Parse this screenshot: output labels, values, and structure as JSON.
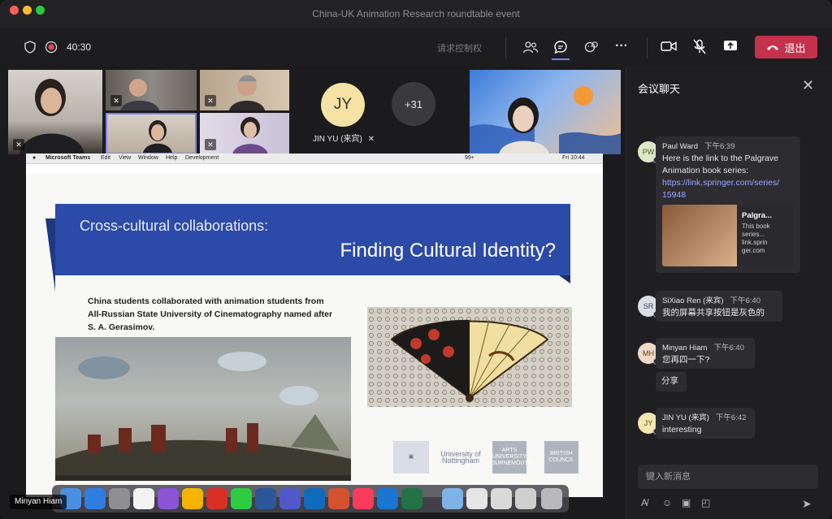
{
  "window": {
    "title": "China-UK Animation Research roundtable event"
  },
  "toolbar": {
    "timer": "40:30",
    "request_control": "请求控制权",
    "leave_label": "退出",
    "icons": [
      "shield-icon",
      "record-icon",
      "people-icon",
      "chat-icon",
      "reactions-icon",
      "more-icon",
      "camera-icon",
      "mic-off-icon",
      "share-icon",
      "phone-icon"
    ]
  },
  "participants": {
    "jin_yu_initials": "JY",
    "jin_yu_name": "JIN YU (来宾)",
    "overflow_count": "+31"
  },
  "shared_screen": {
    "menubar": {
      "app": "Microsoft Teams",
      "items": [
        "Edit",
        "View",
        "Window",
        "Help",
        "Development"
      ],
      "status_badge": "99+",
      "clock": "Fri 10:44"
    },
    "slide": {
      "title_line1": "Cross-cultural collaborations:",
      "title_line2": "Finding Cultural Identity?",
      "body_lines": [
        "China students collaborated with animation students from",
        "All-Russian State University of Cinematography named after",
        "S. A. Gerasimov."
      ],
      "logos": [
        "University of Nottingham",
        "ARTS UNIVERSITY BOURNEMOUTH",
        "BRITISH COUNCIL"
      ]
    },
    "presenter_name": "Minyan Hiam"
  },
  "chat": {
    "title": "会议聊天",
    "messages": [
      {
        "initials": "PW",
        "name": "Paul Ward",
        "time": "下午6:39",
        "lines": [
          "Here is the link to the Palgrave",
          "Animation book series:"
        ],
        "link_lines": [
          "https://link.springer.com/series/",
          "15948"
        ],
        "preview": {
          "title": "Palgra...",
          "desc_lines": [
            "This book",
            "series..."
          ],
          "domain_lines": [
            "link.sprin",
            "ger.com"
          ]
        }
      },
      {
        "initials": "SR",
        "name": "SiXiao Ren (来宾)",
        "time": "下午6:40",
        "lines": [
          "我的屏幕共享按钮是灰色的"
        ]
      },
      {
        "initials": "MH",
        "name": "Minyan Hiam",
        "time": "下午6:40",
        "lines": [
          "您再四一下?"
        ],
        "extra": "分享"
      },
      {
        "initials": "JY",
        "name": "JIN YU (来宾)",
        "time": "下午6:42",
        "lines": [
          "interesting"
        ]
      }
    ],
    "compose_placeholder": "键入新消息"
  },
  "colors": {
    "accent": "#7b83eb",
    "leave": "#c4314b",
    "slide_banner": "#2c4aa8",
    "chat_bg": "#1f1f22"
  }
}
